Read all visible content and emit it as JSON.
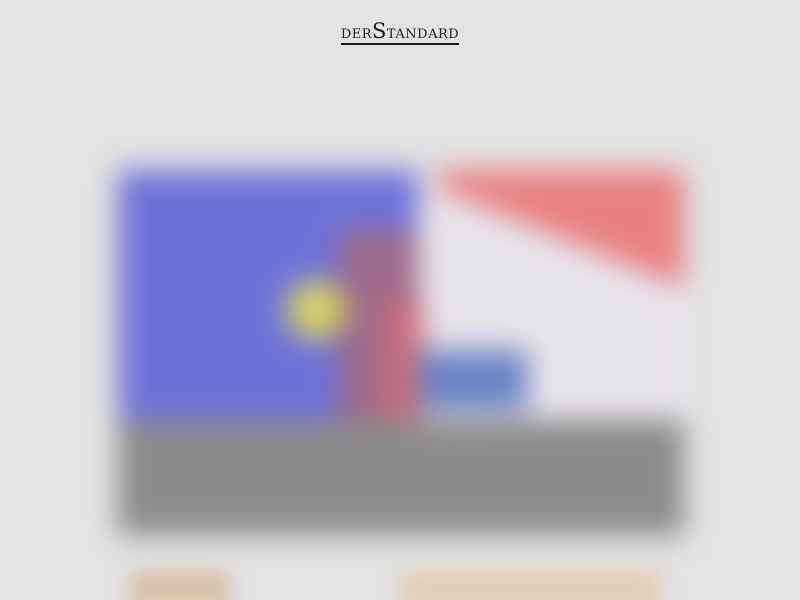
{
  "header": {
    "logo_prefix": "der",
    "logo_cap": "S",
    "logo_rest": "tandard"
  }
}
